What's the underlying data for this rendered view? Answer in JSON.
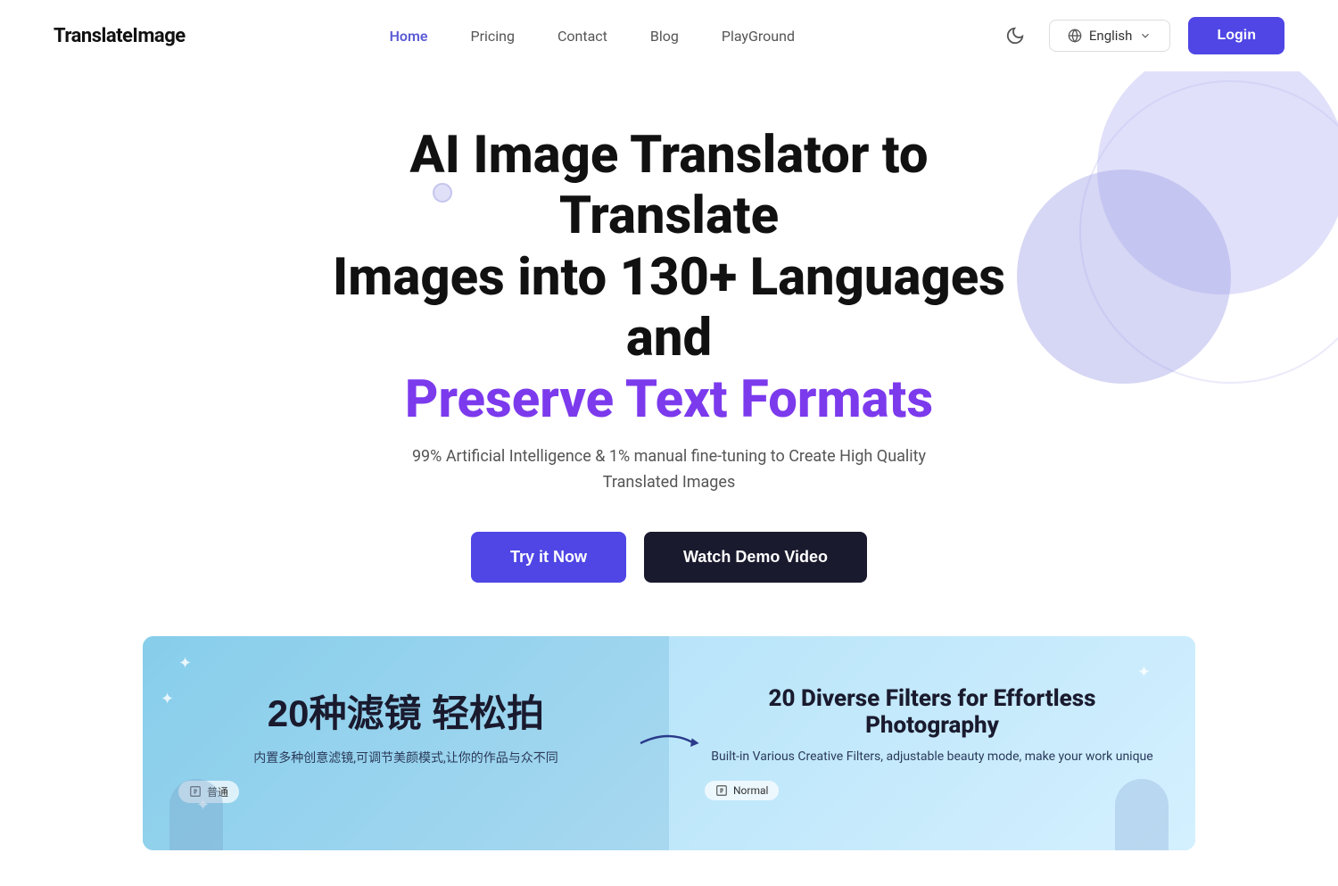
{
  "brand": {
    "logo": "TranslateImage"
  },
  "nav": {
    "links": [
      {
        "label": "Home",
        "active": true
      },
      {
        "label": "Pricing",
        "active": false
      },
      {
        "label": "Contact",
        "active": false
      },
      {
        "label": "Blog",
        "active": false
      },
      {
        "label": "PlayGround",
        "active": false
      }
    ],
    "language": "English",
    "login_label": "Login"
  },
  "hero": {
    "title_line1": "AI Image Translator to Translate",
    "title_line2": "Images into 130+ Languages and",
    "title_accent": "Preserve Text Formats",
    "subtitle": "99% Artificial Intelligence & 1% manual fine-tuning to Create High Quality Translated Images",
    "try_button": "Try it Now",
    "demo_button": "Watch Demo Video"
  },
  "demo": {
    "left": {
      "title": "20种滤镜 轻松拍",
      "subtitle": "内置多种创意滤镜,可调节美颜模式,让你的作品与众不同",
      "badge": "普通"
    },
    "right": {
      "title": "20 Diverse Filters for Effortless Photography",
      "subtitle": "Built-in Various Creative Filters, adjustable beauty mode, make your work unique",
      "badge": "Normal"
    }
  }
}
